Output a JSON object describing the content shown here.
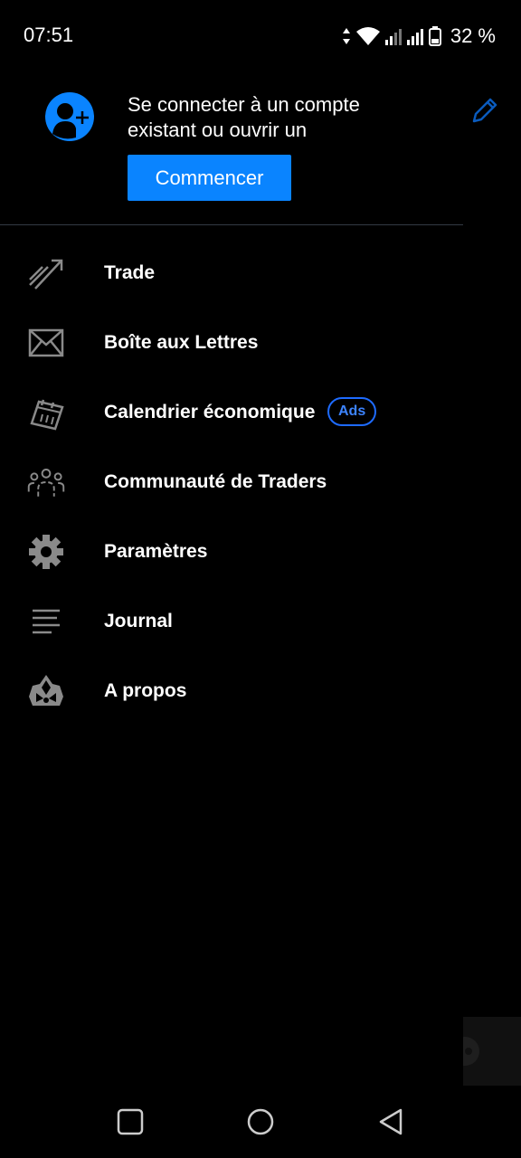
{
  "status_bar": {
    "time": "07:51",
    "battery": "32 %",
    "icons": [
      "data-arrows-icon",
      "wifi-icon",
      "signal-icon",
      "signal-icon",
      "battery-icon"
    ]
  },
  "header": {
    "login_text": "Se connecter à un compte existant ou ouvrir un",
    "start_button": "Commencer",
    "avatar_icon": "add-account-icon",
    "edit_icon": "pencil-icon"
  },
  "menu": {
    "items": [
      {
        "label": "Trade",
        "icon": "trade-chart-icon"
      },
      {
        "label": "Boîte aux Lettres",
        "icon": "mail-icon"
      },
      {
        "label": "Calendrier économique",
        "icon": "calendar-icon",
        "badge": "Ads"
      },
      {
        "label": "Communauté de Traders",
        "icon": "community-icon"
      },
      {
        "label": "Paramètres",
        "icon": "gear-icon"
      },
      {
        "label": "Journal",
        "icon": "journal-icon"
      },
      {
        "label": "A propos",
        "icon": "about-icon"
      }
    ]
  },
  "nav_bar": {
    "buttons": [
      "recents-square-icon",
      "home-circle-icon",
      "back-triangle-icon"
    ]
  },
  "colors": {
    "accent": "#0a84ff",
    "badge": "#1e6bff",
    "icon_gray": "#8a8a8a",
    "background": "#000000"
  }
}
